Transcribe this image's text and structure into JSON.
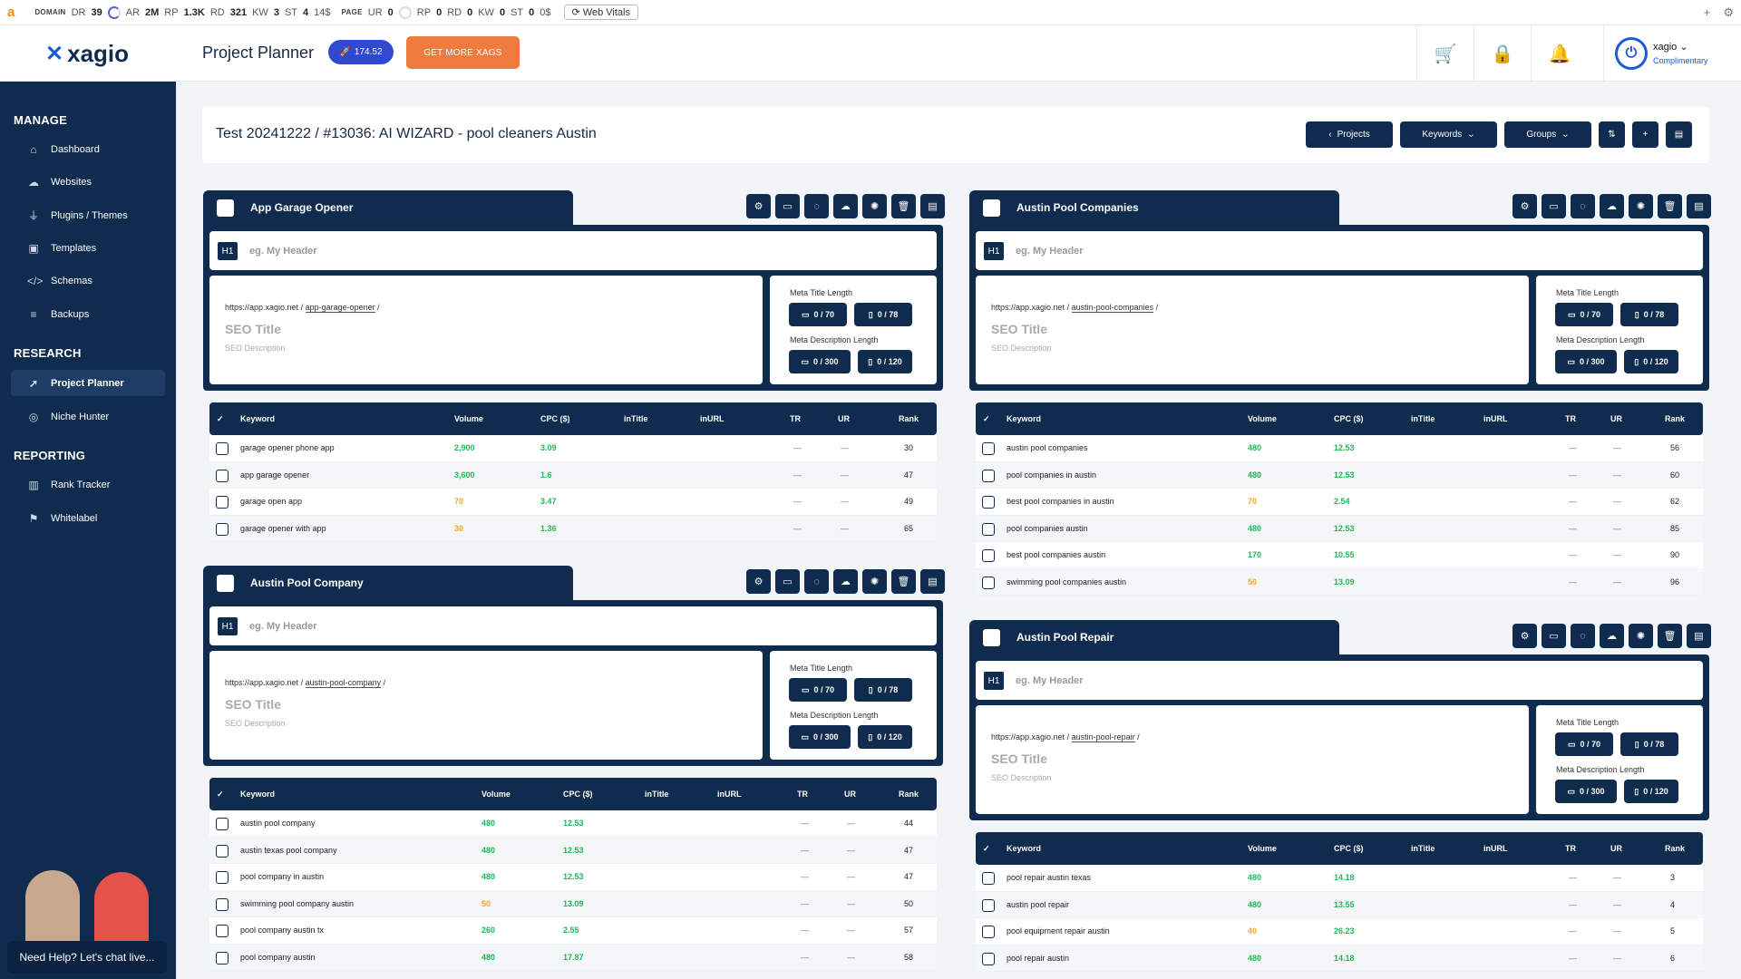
{
  "ahrefs": {
    "logo": "a",
    "domain": "DOMAIN",
    "dr_l": "DR",
    "dr": "39",
    "ar_l": "AR",
    "ar": "2M",
    "rp_l": "RP",
    "rp": "1.3K",
    "rd_l": "RD",
    "rd": "321",
    "kw_l": "KW",
    "kw": "3",
    "st_l": "ST",
    "st": "4",
    "st_val": "14$",
    "page": "PAGE",
    "ur_l": "UR",
    "ur": "0",
    "prp_l": "RP",
    "prp": "0",
    "prd_l": "RD",
    "prd": "0",
    "pkw_l": "KW",
    "pkw": "0",
    "pst_l": "ST",
    "pst": "0",
    "pst_val": "0$",
    "webvitals": "Web Vitals"
  },
  "topnav": {
    "brand": "xagio",
    "title": "Project Planner",
    "credits": "174.52",
    "get_more": "GET MORE XAGS",
    "user_name": "xagio",
    "user_tier": "Complimentary"
  },
  "sidebar": {
    "manage": "MANAGE",
    "research": "RESEARCH",
    "reporting": "REPORTING",
    "items": [
      {
        "label": "Dashboard",
        "icon": "home-icon"
      },
      {
        "label": "Websites",
        "icon": "cloud-icon"
      },
      {
        "label": "Plugins / Themes",
        "icon": "plug-icon"
      },
      {
        "label": "Templates",
        "icon": "image-icon"
      },
      {
        "label": "Schemas",
        "icon": "code-icon"
      },
      {
        "label": "Backups",
        "icon": "database-icon"
      },
      {
        "label": "Project Planner",
        "icon": "rocket-icon"
      },
      {
        "label": "Niche Hunter",
        "icon": "crosshair-icon"
      },
      {
        "label": "Rank Tracker",
        "icon": "chart-icon"
      },
      {
        "label": "Whitelabel",
        "icon": "bookmark-icon"
      }
    ],
    "chat": "Need Help? Let's chat live..."
  },
  "header": {
    "title": "Test 20241222 / #13036: AI WIZARD - pool cleaners Austin",
    "projects": "Projects",
    "keywords": "Keywords",
    "groups": "Groups"
  },
  "labels": {
    "h1": "H1",
    "h1_placeholder": "eg. My Header",
    "seo_title": "SEO Title",
    "seo_desc": "SEO Description",
    "meta_title": "Meta Title Length",
    "meta_desc": "Meta Description Length",
    "mt_desktop": "0 / 70",
    "mt_mobile": "0 / 78",
    "md_desktop": "0 / 300",
    "md_mobile": "0 / 120",
    "col_keyword": "Keyword",
    "col_volume": "Volume",
    "col_cpc": "CPC ($)",
    "col_intitle": "inTitle",
    "col_inurl": "inURL",
    "col_tr": "TR",
    "col_ur": "UR",
    "col_rank": "Rank"
  },
  "groups": [
    {
      "name": "App Garage Opener",
      "base": "https://app.xagio.net",
      "slug": "app-garage-opener",
      "rows": [
        [
          "garage opener phone app",
          "2,900",
          "g",
          "3.09",
          "30"
        ],
        [
          "app garage opener",
          "3,600",
          "g",
          "1.6",
          "47"
        ],
        [
          "garage open app",
          "70",
          "o",
          "3.47",
          "49"
        ],
        [
          "garage opener with app",
          "30",
          "o",
          "1.36",
          "65"
        ]
      ]
    },
    {
      "name": "Austin Pool Companies",
      "base": "https://app.xagio.net",
      "slug": "austin-pool-companies",
      "rows": [
        [
          "austin pool companies",
          "480",
          "g",
          "12.53",
          "56"
        ],
        [
          "pool companies in austin",
          "480",
          "g",
          "12.53",
          "60"
        ],
        [
          "best pool companies in austin",
          "70",
          "o",
          "2.54",
          "62"
        ],
        [
          "pool companies austin",
          "480",
          "g",
          "12.53",
          "85"
        ],
        [
          "best pool companies austin",
          "170",
          "g",
          "10.55",
          "90"
        ],
        [
          "swimming pool companies austin",
          "50",
          "o",
          "13.09",
          "96"
        ]
      ]
    },
    {
      "name": "Austin Pool Company",
      "base": "https://app.xagio.net",
      "slug": "austin-pool-company",
      "rows": [
        [
          "austin pool company",
          "480",
          "g",
          "12.53",
          "44"
        ],
        [
          "austin texas pool company",
          "480",
          "g",
          "12.53",
          "47"
        ],
        [
          "pool company in austin",
          "480",
          "g",
          "12.53",
          "47"
        ],
        [
          "swimming pool company austin",
          "50",
          "o",
          "13.09",
          "50"
        ],
        [
          "pool company austin tx",
          "260",
          "g",
          "2.55",
          "57"
        ],
        [
          "pool company austin",
          "480",
          "g",
          "17.87",
          "58"
        ]
      ]
    },
    {
      "name": "Austin Pool Repair",
      "base": "https://app.xagio.net",
      "slug": "austin-pool-repair",
      "rows": [
        [
          "pool repair austin texas",
          "480",
          "g",
          "14.18",
          "3"
        ],
        [
          "austin pool repair",
          "480",
          "g",
          "13.55",
          "4"
        ],
        [
          "pool equipment repair austin",
          "40",
          "o",
          "26.23",
          "5"
        ],
        [
          "pool repair austin",
          "480",
          "g",
          "14.18",
          "6"
        ]
      ]
    }
  ],
  "dash": "—",
  "colors": {
    "navy": "#0f2b4d",
    "accent": "#1a5bd6",
    "orange": "#f07b3f",
    "green": "#1db954",
    "amber": "#f5a623"
  }
}
